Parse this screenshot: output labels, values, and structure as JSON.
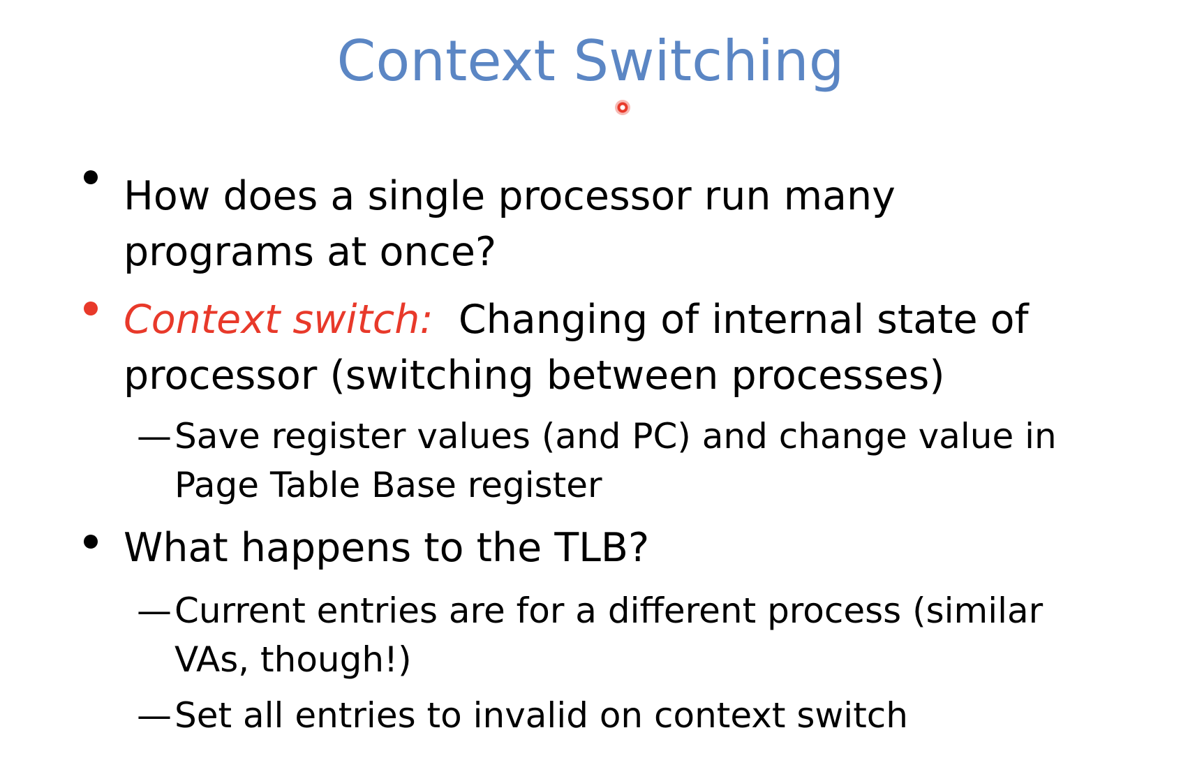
{
  "slide": {
    "title": "Context Switching",
    "colors": {
      "title": "#5b86c4",
      "accent": "#e8392a",
      "text": "#000000",
      "background": "#ffffff"
    },
    "bullets": [
      {
        "lines": [
          "How does a single processor run many",
          "programs at once?"
        ]
      },
      {
        "term": "Context switch:",
        "lines": [
          "Changing of internal state of",
          "processor (switching between processes)"
        ],
        "sub": [
          {
            "dash": "—",
            "lines": [
              "Save register values (and PC) and change value in",
              "Page Table Base register"
            ]
          }
        ]
      },
      {
        "lines": [
          "What happens to the TLB?"
        ],
        "sub": [
          {
            "dash": "—",
            "lines": [
              "Current entries are for a different process (similar",
              "VAs, though!)"
            ]
          },
          {
            "dash": "—",
            "lines": [
              "Set all entries to invalid on context switch"
            ]
          }
        ]
      }
    ]
  }
}
